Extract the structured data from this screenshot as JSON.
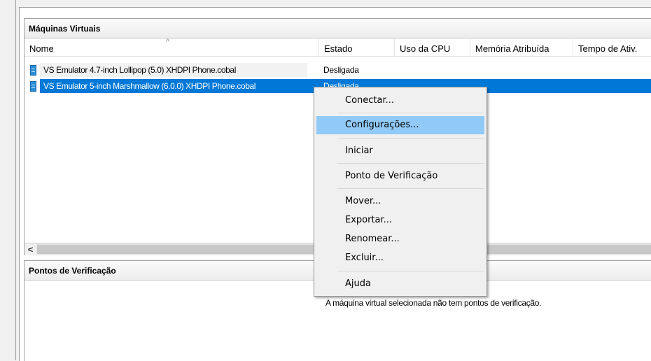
{
  "vm_pane": {
    "title": "Máquinas Virtuais",
    "sort_indicator": "^",
    "columns": [
      "Nome",
      "Estado",
      "Uso da CPU",
      "Memória Atribuída",
      "Tempo de Ativ."
    ],
    "rows": [
      {
        "name": "VS Emulator 4.7-inch Lollipop (5.0) XHDPI Phone.cobal",
        "state": "Desligada",
        "selected": false,
        "icon": "vm-icon"
      },
      {
        "name": "VS Emulator 5-inch Marshmallow (6.0.0) XHDPI Phone.cobal",
        "state": "Desligada",
        "selected": true,
        "icon": "vm-icon"
      }
    ],
    "scroll_left_glyph": "<"
  },
  "checkpoints_pane": {
    "title": "Pontos de Verificação",
    "empty_message": "A máquina virtual selecionada não tem pontos de verificação."
  },
  "context_menu": {
    "highlighted": "Configurações...",
    "items": [
      "Conectar...",
      "Configurações...",
      "Iniciar",
      "Ponto de Verificação",
      "Mover...",
      "Exportar...",
      "Renomear...",
      "Excluir...",
      "Ajuda"
    ]
  },
  "colors": {
    "selection": "#0078d7",
    "menu_highlight": "#91c9f7",
    "menu_background": "#f0f0f0"
  }
}
